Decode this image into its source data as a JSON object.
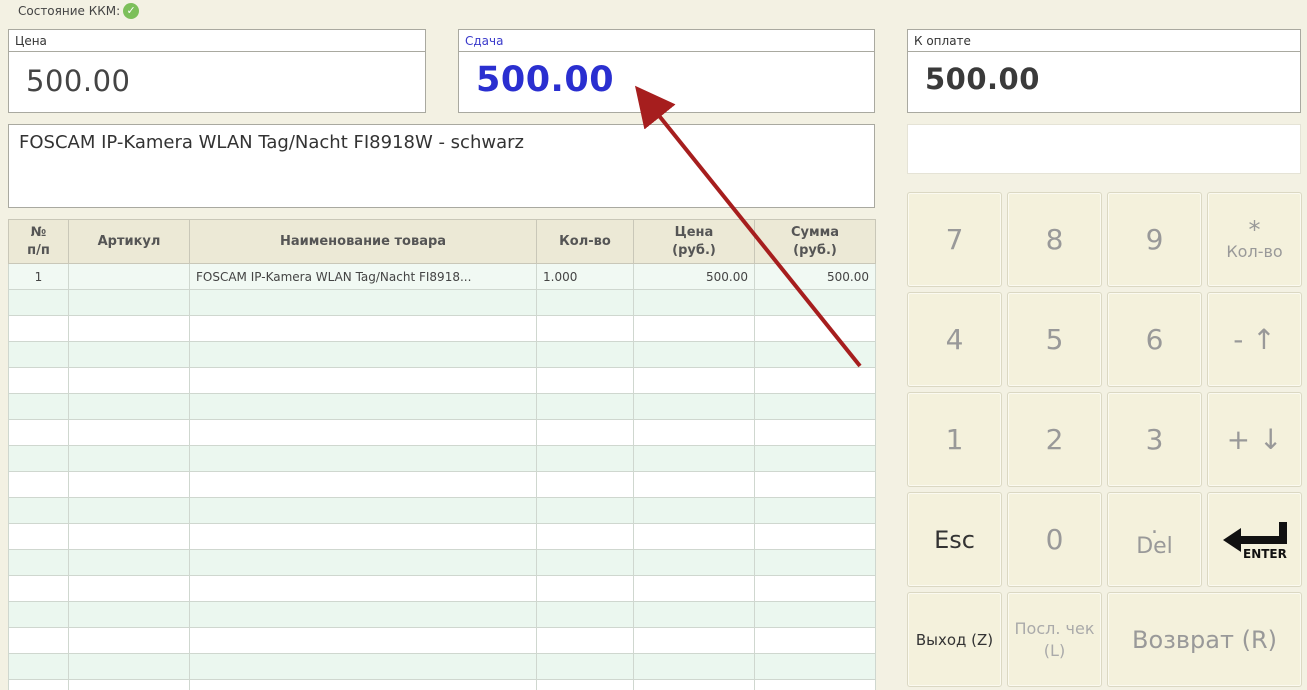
{
  "status": {
    "label": "Состояние ККМ:",
    "icon": "check-icon"
  },
  "price": {
    "label": "Цена",
    "value": "500.00"
  },
  "change": {
    "label": "Сдача",
    "value": "500.00"
  },
  "to_pay": {
    "label": "К оплате",
    "value": "500.00"
  },
  "product_description": "FOSCAM IP-Kamera WLAN Tag/Nacht FI8918W - schwarz",
  "table": {
    "headers": {
      "num_line1": "№",
      "num_line2": "п/п",
      "article": "Артикул",
      "name": "Наименование товара",
      "qty": "Кол-во",
      "price_line1": "Цена",
      "price_line2": "(руб.)",
      "sum_line1": "Сумма",
      "sum_line2": "(руб.)"
    },
    "rows": [
      {
        "num": "1",
        "article": "",
        "name": "FOSCAM IP-Kamera WLAN Tag/Nacht FI8918...",
        "qty": "1.000",
        "price": "500.00",
        "sum": "500.00"
      }
    ]
  },
  "keypad": {
    "k7": "7",
    "k8": "8",
    "k9": "9",
    "star": "*",
    "qty_label": "Кол-во",
    "k4": "4",
    "k5": "5",
    "k6": "6",
    "minus_up": "- ↑",
    "k1": "1",
    "k2": "2",
    "k3": "3",
    "plus_down": "+ ↓",
    "esc": "Esc",
    "k0": "0",
    "dot": ".",
    "del": "Del",
    "enter": "ENTER",
    "exit": "Выход (Z)",
    "last_check_line1": "Посл. чек",
    "last_check_line2": "(L)",
    "refund": "Возврат (R)"
  },
  "annotation_color": "#a61e1e"
}
